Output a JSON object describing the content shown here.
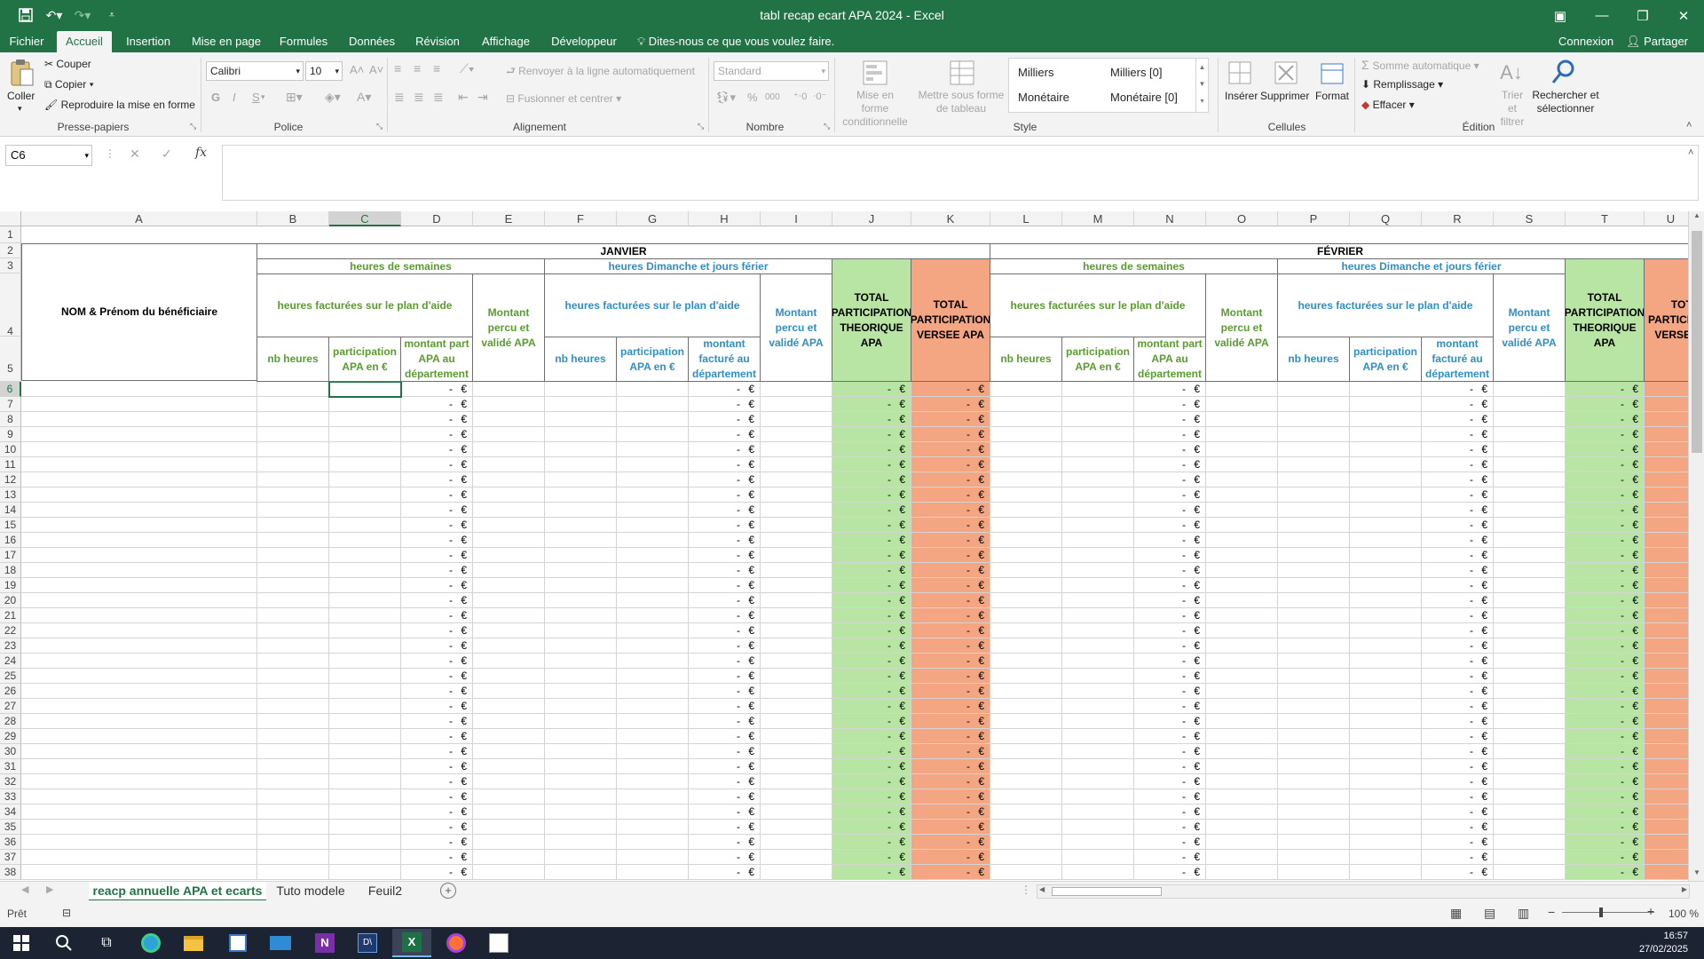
{
  "window": {
    "title": "tabl recap ecart APA 2024 - Excel"
  },
  "menu": {
    "tabs": [
      "Fichier",
      "Accueil",
      "Insertion",
      "Mise en page",
      "Formules",
      "Données",
      "Révision",
      "Affichage",
      "Développeur"
    ],
    "active_tab": "Accueil",
    "tell_me": "Dites-nous ce que vous voulez faire.",
    "connexion": "Connexion",
    "share": "Partager"
  },
  "ribbon": {
    "clipboard": {
      "paste": "Coller",
      "cut": "Couper",
      "copy": "Copier",
      "format_painter": "Reproduire la mise en forme",
      "label": "Presse-papiers"
    },
    "font": {
      "name": "Calibri",
      "size": "10",
      "bold": "G",
      "italic": "I",
      "underline": "S",
      "label": "Police"
    },
    "alignment": {
      "wrap": "Renvoyer à la ligne automatiquement",
      "merge": "Fusionner et centrer",
      "label": "Alignement"
    },
    "number": {
      "format": "Standard",
      "label": "Nombre"
    },
    "styles": {
      "conditional": "Mise en forme conditionnelle",
      "as_table": "Mettre sous forme de tableau",
      "cells": [
        "Milliers",
        "Milliers [0]",
        "Monétaire",
        "Monétaire [0]"
      ],
      "label": "Style"
    },
    "cells": {
      "insert": "Insérer",
      "delete": "Supprimer",
      "format": "Format",
      "label": "Cellules"
    },
    "editing": {
      "autosum": "Somme automatique",
      "fill": "Remplissage",
      "clear": "Effacer",
      "sort": "Trier et filtrer",
      "find": "Rechercher et sélectionner",
      "label": "Édition"
    }
  },
  "formula_bar": {
    "name_box": "C6",
    "fx": "fx",
    "value": ""
  },
  "sheet": {
    "columns": [
      "A",
      "B",
      "C",
      "D",
      "E",
      "F",
      "G",
      "H",
      "I",
      "J",
      "K",
      "L",
      "M",
      "N",
      "O",
      "P",
      "Q",
      "R",
      "S",
      "T",
      "U"
    ],
    "selected_column": "C",
    "selected_row": 6,
    "header_name": "NOM & Prénom du bénéficiaire",
    "months": [
      "JANVIER",
      "FÉVRIER"
    ],
    "week_hours": "heures de semaines",
    "sunday_hours": "heures Dimanche et jours férier",
    "billed_hours": "heures facturées sur le plan d'aide",
    "montant_percu": "Montant percu et validé APA",
    "total_theorique": "TOTAL PARTICIPATION THEORIQUE APA",
    "total_versee": "TOTAL PARTICIPATION VERSEE APA",
    "nb_heures": "nb heures",
    "participation": "participation APA en €",
    "montant_part": "montant part APA au département",
    "montant_facture": "montant facturé au département",
    "dash_value": "-",
    "euro": "€",
    "colors": {
      "green_fill": "#b8e5a4",
      "orange_fill": "#f4a582",
      "green_text": "#5a9c2f",
      "blue_text": "#2f8fc6"
    }
  },
  "sheet_tabs": [
    "reacp annuelle APA et ecarts",
    "Tuto modele",
    "Feuil2"
  ],
  "active_sheet": "reacp annuelle APA et ecarts",
  "status": {
    "ready": "Prêt",
    "zoom": "100 %"
  },
  "taskbar": {
    "time": "16:57",
    "date": "27/02/2025"
  }
}
